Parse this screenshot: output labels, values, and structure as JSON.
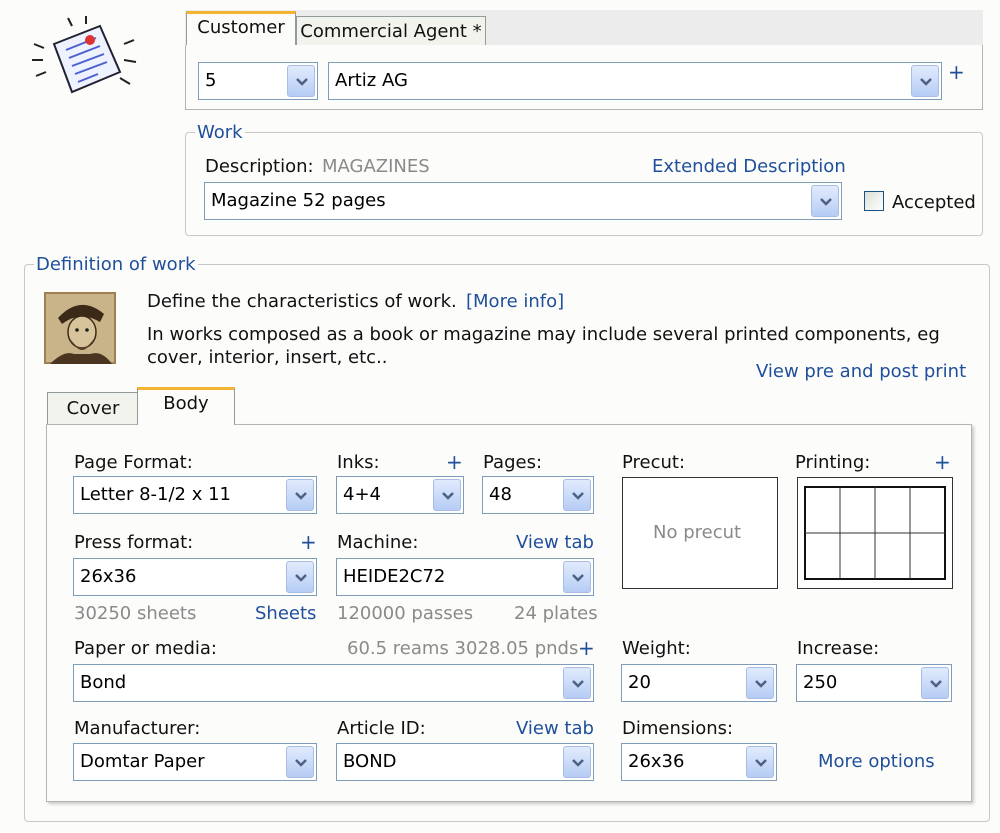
{
  "customer": {
    "tabs": [
      {
        "label": "Customer"
      },
      {
        "label": "Commercial Agent *"
      }
    ],
    "code": "5",
    "name": "Artiz AG",
    "add": "+"
  },
  "work": {
    "legend": "Work",
    "description_label": "Description:",
    "description_value": "MAGAZINES",
    "extended_link": "Extended Description",
    "selected": "Magazine 52 pages",
    "accepted_label": "Accepted"
  },
  "definition": {
    "legend": "Definition of work",
    "line1": "Define the characteristics of work.",
    "more_info": "[More info]",
    "line2": "In works composed as a book or magazine may include several printed components, eg",
    "line3": "cover, interior, insert, etc..",
    "view_pre_post": "View pre and post print",
    "tabs": [
      {
        "label": "Cover"
      },
      {
        "label": "Body"
      }
    ]
  },
  "body": {
    "page_format": {
      "label": "Page Format:",
      "value": "Letter 8-1/2 x 11"
    },
    "inks": {
      "label": "Inks:",
      "plus": "+",
      "value": "4+4"
    },
    "pages": {
      "label": "Pages:",
      "value": "48"
    },
    "precut": {
      "label": "Precut:",
      "text": "No precut"
    },
    "printing": {
      "label": "Printing:",
      "plus": "+"
    },
    "press_format": {
      "label": "Press format:",
      "plus": "+",
      "value": "26x36",
      "sheets_info": "30250 sheets",
      "sheets_link": "Sheets"
    },
    "machine": {
      "label": "Machine:",
      "view_tab": "View tab",
      "value": "HEIDE2C72",
      "passes": "120000 passes",
      "plates": "24 plates"
    },
    "paper": {
      "label": "Paper or media:",
      "reams": "60.5 reams 3028.05 pnds",
      "plus": "+",
      "value": "Bond"
    },
    "weight": {
      "label": "Weight:",
      "value": "20"
    },
    "increase": {
      "label": "Increase:",
      "value": "250"
    },
    "manufacturer": {
      "label": "Manufacturer:",
      "value": "Domtar Paper"
    },
    "article": {
      "label": "Article ID:",
      "view_tab": "View tab",
      "value": "BOND"
    },
    "dimensions": {
      "label": "Dimensions:",
      "value": "26x36"
    },
    "more_options": "More options"
  },
  "colors": {
    "link": "#1f4f9a",
    "tab_accent": "#f3b433",
    "combo_border": "#7f9db9"
  }
}
